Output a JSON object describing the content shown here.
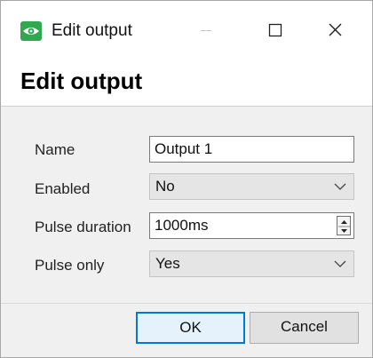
{
  "window": {
    "title": "Edit output",
    "icon": "eye-app-icon"
  },
  "titlebar_buttons": {
    "minimize": "minimize-icon",
    "maximize": "maximize-icon",
    "close": "close-icon"
  },
  "header": {
    "title": "Edit output"
  },
  "form": {
    "name_label": "Name",
    "name_value": "Output 1",
    "enabled_label": "Enabled",
    "enabled_value": "No",
    "pulse_duration_label": "Pulse duration",
    "pulse_duration_value": "1000ms",
    "pulse_only_label": "Pulse only",
    "pulse_only_value": "Yes"
  },
  "buttons": {
    "ok_label": "OK",
    "cancel_label": "Cancel"
  },
  "colors": {
    "accent": "#0078d7",
    "app_icon": "#2fa84f"
  }
}
